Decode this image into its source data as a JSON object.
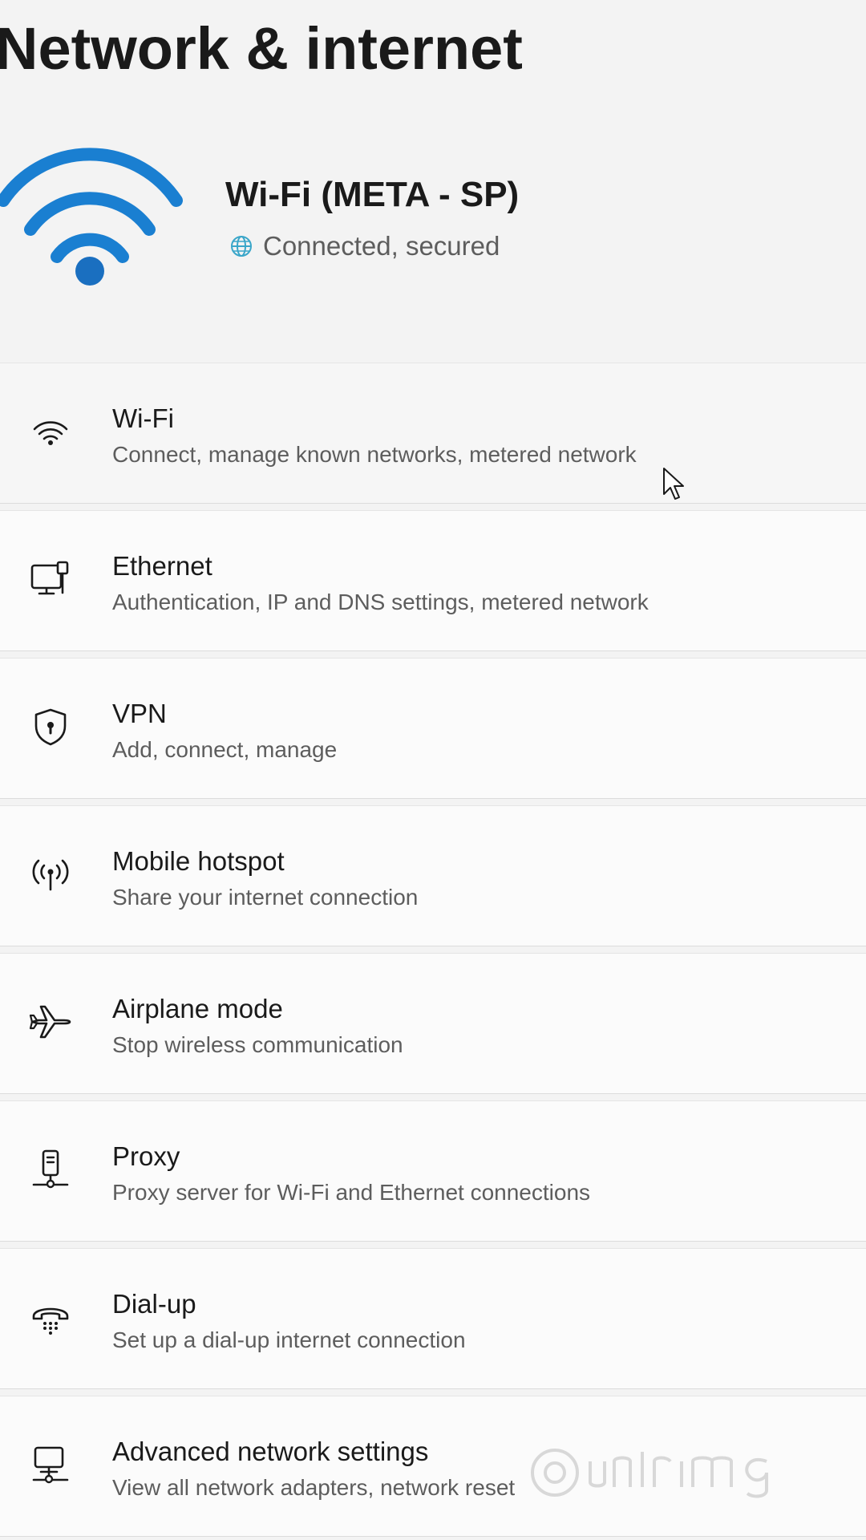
{
  "page": {
    "title": "Network & internet"
  },
  "hero": {
    "network_name": "Wi-Fi (META - SP)",
    "status": "Connected, secured",
    "icon": "wifi-large-icon",
    "accent_color": "#1a7fd1"
  },
  "items": [
    {
      "title": "Wi-Fi",
      "description": "Connect, manage known networks, metered network",
      "icon": "wifi-icon"
    },
    {
      "title": "Ethernet",
      "description": "Authentication, IP and DNS settings, metered network",
      "icon": "ethernet-icon"
    },
    {
      "title": "VPN",
      "description": "Add, connect, manage",
      "icon": "shield-icon"
    },
    {
      "title": "Mobile hotspot",
      "description": "Share your internet connection",
      "icon": "hotspot-icon"
    },
    {
      "title": "Airplane mode",
      "description": "Stop wireless communication",
      "icon": "airplane-icon"
    },
    {
      "title": "Proxy",
      "description": "Proxy server for Wi-Fi and Ethernet connections",
      "icon": "proxy-icon"
    },
    {
      "title": "Dial-up",
      "description": "Set up a dial-up internet connection",
      "icon": "dialup-icon"
    },
    {
      "title": "Advanced network settings",
      "description": "View all network adapters, network reset",
      "icon": "advanced-network-icon"
    }
  ]
}
